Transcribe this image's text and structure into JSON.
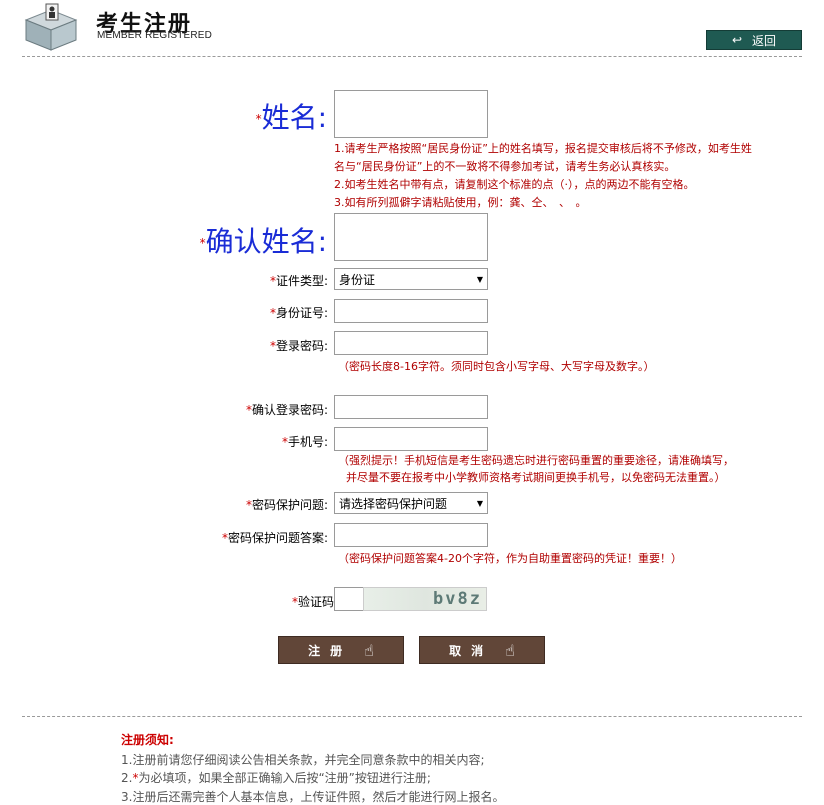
{
  "header": {
    "title": "考生注册",
    "subtitle": "MEMBER REGISTERED",
    "back_label": "返回"
  },
  "form": {
    "name_label": "姓名:",
    "name_notes": [
      "1.请考生严格按照“居民身份证”上的姓名填写，报名提交审核后将不予修改，如考生姓",
      "名与“居民身份证”上的不一致将不得参加考试，请考生务必认真核实。",
      "2.如考生姓名中带有点，请复制这个标准的点（·），点的两边不能有空格。",
      "3.如有所列孤僻字请粘贴使用，例：龚、仝、　、　。"
    ],
    "confirm_name_label": "确认姓名:",
    "id_type_label": "证件类型:",
    "id_type_value": "身份证",
    "id_number_label": "身份证号:",
    "password_label": "登录密码:",
    "password_note": "（密码长度8-16字符。须同时包含小写字母、大写字母及数字。）",
    "confirm_password_label": "确认登录密码:",
    "phone_label": "手机号:",
    "phone_notes": [
      "（强烈提示！手机短信是考生密码遗忘时进行密码重置的重要途径，请准确填写，",
      "并尽量不要在报考中小学教师资格考试期间更换手机号，以免密码无法重置。）"
    ],
    "question_label": "密码保护问题:",
    "question_value": "请选择密码保护问题",
    "answer_label": "密码保护问题答案:",
    "answer_note": "（密码保护问题答案4-20个字符，作为自助重置密码的凭证！重要！）",
    "captcha_label": "验证码",
    "captcha_text": "bv8z",
    "required_mark": "*"
  },
  "buttons": {
    "register": "注册",
    "cancel": "取消"
  },
  "notice": {
    "title": "注册须知:",
    "line1": "1.注册前请您仔细阅读公告相关条款，并完全同意条款中的相关内容;",
    "line2_prefix": "2.",
    "line2_star": "*",
    "line2_rest": "为必填项，如果全部正确输入后按“注册”按钮进行注册;",
    "line3": "3.注册后还需完善个人基本信息，上传证件照，然后才能进行网上报名。"
  },
  "colors": {
    "label_blue": "#1a2cd6",
    "note_red": "#b00000",
    "button_brown": "#614638",
    "back_green": "#1f5a52"
  }
}
